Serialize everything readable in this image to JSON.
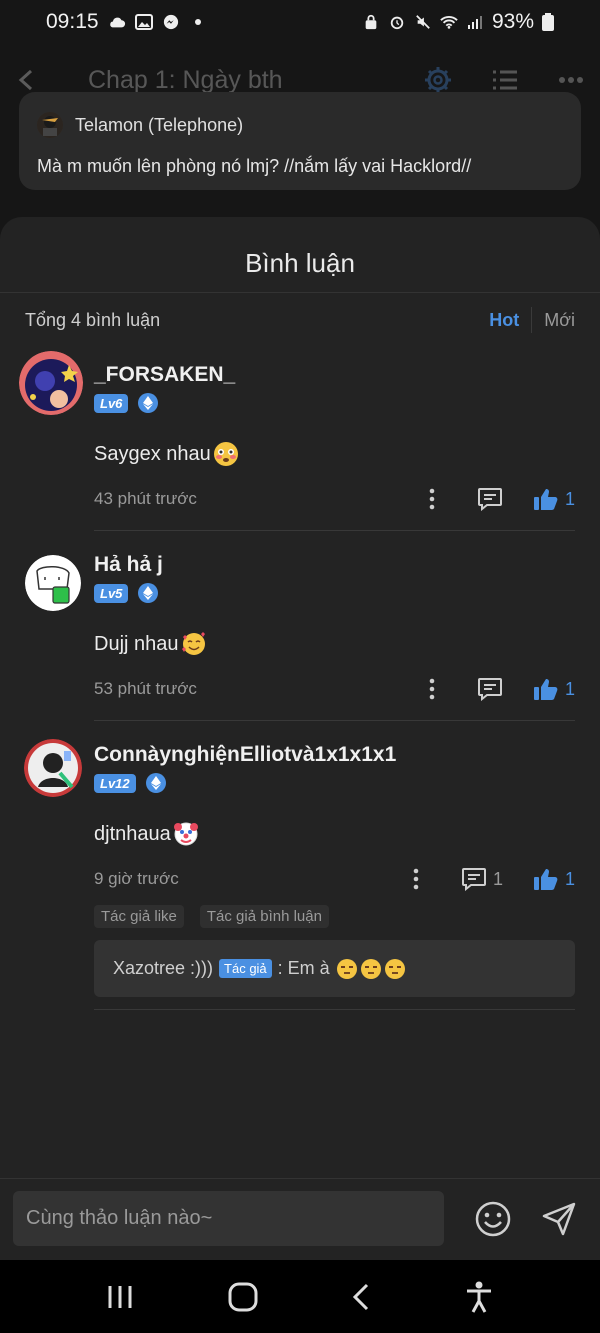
{
  "status_bar": {
    "time": "09:15",
    "battery": "93%"
  },
  "top_bar": {
    "title": "Chap 1: Ngày bth"
  },
  "quote": {
    "author": "Telamon (Telephone)",
    "text": "Mà m muốn lên phòng nó lmj? //nắm lấy vai Hacklord//"
  },
  "comments_sheet": {
    "title": "Bình luận",
    "total": "Tổng 4 bình luận",
    "sort_tabs": [
      "Hot",
      "Mới"
    ],
    "active_sort": "Hot"
  },
  "comments": [
    {
      "name": "_FORSAKEN_",
      "level": "Lv6",
      "text": "Saygex nhau",
      "emoji": "flushed-face",
      "time": "43 phút trước",
      "reply_count": "",
      "like_count": "1"
    },
    {
      "name": "Hả hả j",
      "level": "Lv5",
      "text": "Dujj nhau",
      "emoji": "smiling-face-with-hearts",
      "time": "53 phút trước",
      "reply_count": "",
      "like_count": "1"
    },
    {
      "name": "ConnàynghiệnElliotvà1x1x1x1",
      "level": "Lv12",
      "text": "djtnhaua",
      "emoji": "clown-face",
      "time": "9 giờ trước",
      "reply_count": "1",
      "like_count": "1",
      "tags": [
        "Tác giả like",
        "Tác giả bình luận"
      ],
      "reply": {
        "author": "Xazotree :)))",
        "author_tag": "Tác giả",
        "text": ": Em à",
        "emojis": [
          "unamused-face",
          "unamused-face",
          "unamused-face"
        ]
      }
    }
  ],
  "input": {
    "placeholder": "Cùng thảo luận nào~"
  },
  "colors": {
    "accent": "#4a90e2",
    "background": "#161616",
    "sheet": "#232323"
  }
}
